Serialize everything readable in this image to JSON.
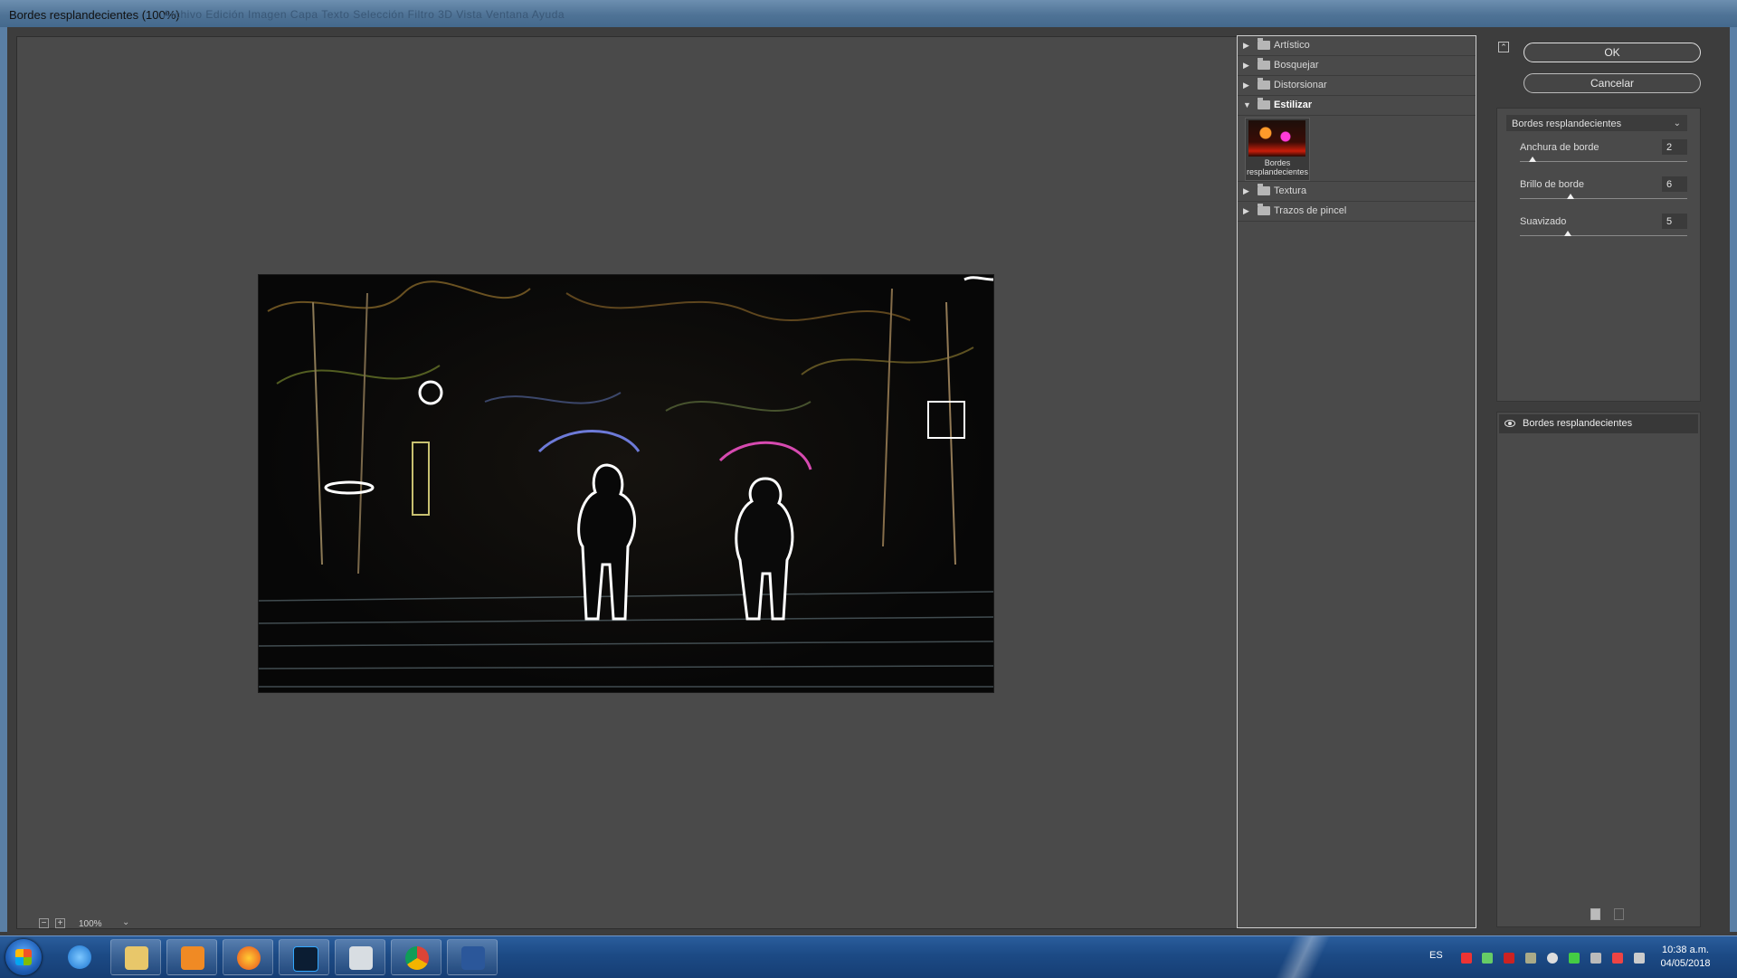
{
  "window": {
    "title": "Bordes resplandecientes (100%)",
    "ghost_menu": "Archivo  Edición  Imagen  Capa  Texto  Selección  Filtro  3D  Vista  Ventana  Ayuda"
  },
  "preview": {
    "zoom": "100%",
    "zoom_out": "−",
    "zoom_in": "+",
    "zoom_dropdown": "⌄"
  },
  "gallery": {
    "categories": [
      {
        "label": "Artístico",
        "open": false
      },
      {
        "label": "Bosquejar",
        "open": false
      },
      {
        "label": "Distorsionar",
        "open": false
      },
      {
        "label": "Estilizar",
        "open": true
      },
      {
        "label": "Textura",
        "open": false
      },
      {
        "label": "Trazos de pincel",
        "open": false
      }
    ],
    "thumb_caption": "Bordes resplandecientes",
    "collapsed_arrow": "▶",
    "expanded_arrow": "▼"
  },
  "buttons": {
    "ok": "OK",
    "cancel": "Cancelar",
    "collapse": "⌃"
  },
  "params": {
    "selected_filter": "Bordes resplandecientes",
    "chevron": "⌄",
    "items": [
      {
        "label": "Anchura de borde",
        "value": "2",
        "min": 1,
        "max": 14
      },
      {
        "label": "Brillo de borde",
        "value": "6",
        "min": 0,
        "max": 20
      },
      {
        "label": "Suavizado",
        "value": "5",
        "min": 1,
        "max": 15
      }
    ]
  },
  "layers": {
    "items": [
      {
        "name": "Bordes resplandecientes",
        "visible": true
      }
    ]
  },
  "taskbar": {
    "apps": [
      "internet-explorer",
      "file-explorer",
      "media-player",
      "firefox",
      "photoshop",
      "notes",
      "chrome",
      "word"
    ],
    "lang": "ES",
    "time": "10:38 a.m.",
    "date": "04/05/2018"
  }
}
